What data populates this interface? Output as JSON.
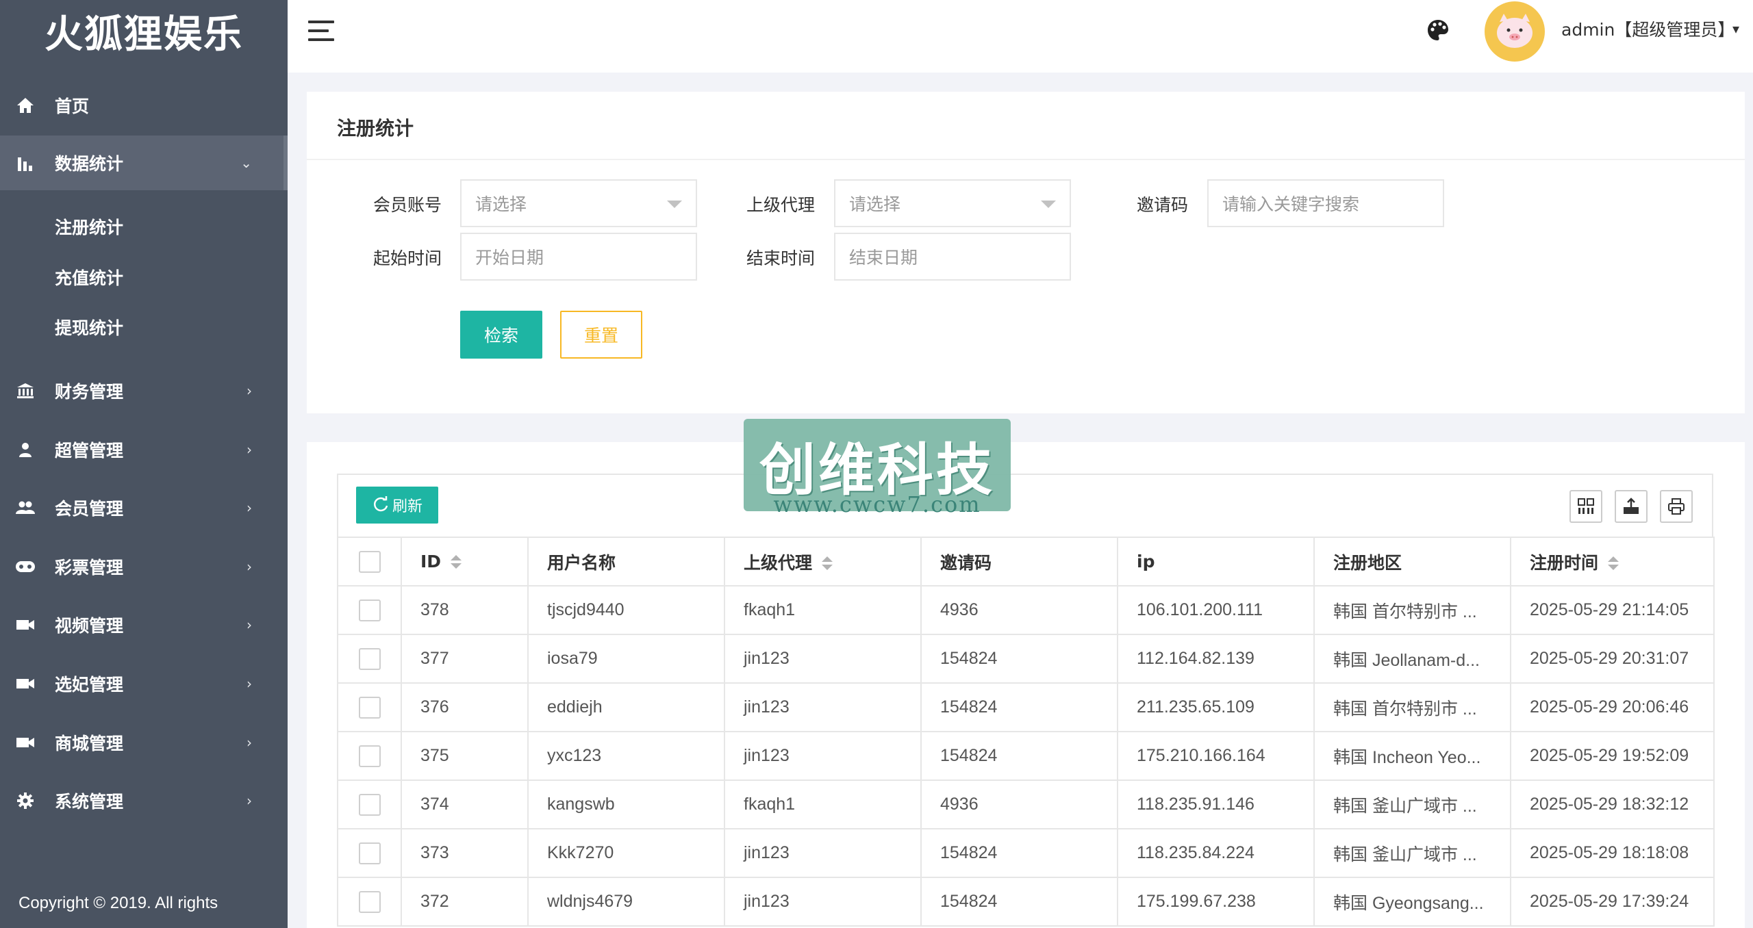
{
  "app": {
    "logo": "火狐狸娱乐"
  },
  "sidebar": {
    "items": [
      {
        "label": "首页",
        "icon": "home-icon"
      },
      {
        "label": "数据统计",
        "icon": "bar-chart-icon",
        "expanded": true
      },
      {
        "label": "财务管理",
        "icon": "bank-icon"
      },
      {
        "label": "超管管理",
        "icon": "user-icon"
      },
      {
        "label": "会员管理",
        "icon": "users-icon"
      },
      {
        "label": "彩票管理",
        "icon": "gamepad-icon"
      },
      {
        "label": "视频管理",
        "icon": "video-icon"
      },
      {
        "label": "选妃管理",
        "icon": "video-icon"
      },
      {
        "label": "商城管理",
        "icon": "video-icon"
      },
      {
        "label": "系统管理",
        "icon": "gear-icon"
      }
    ],
    "subitems": [
      "注册统计",
      "充值统计",
      "提现统计"
    ],
    "copyright": "Copyright © 2019. All rights"
  },
  "header": {
    "user": "admin【超级管理员】"
  },
  "search": {
    "title": "注册统计",
    "member_label": "会员账号",
    "member_placeholder": "请选择",
    "agent_label": "上级代理",
    "agent_placeholder": "请选择",
    "invite_label": "邀请码",
    "invite_placeholder": "请输入关键字搜索",
    "start_label": "起始时间",
    "start_placeholder": "开始日期",
    "end_label": "结束时间",
    "end_placeholder": "结束日期",
    "search_button": "检索",
    "reset_button": "重置"
  },
  "table": {
    "refresh_label": "刷新",
    "columns": [
      "ID",
      "用户名称",
      "上级代理",
      "邀请码",
      "ip",
      "注册地区",
      "注册时间"
    ],
    "rows": [
      [
        "378",
        "tjscjd9440",
        "fkaqh1",
        "4936",
        "106.101.200.111",
        "韩国 首尔特别市 ...",
        "2025-05-29 21:14:05"
      ],
      [
        "377",
        "iosa79",
        "jin123",
        "154824",
        "112.164.82.139",
        "韩国 Jeollanam-d...",
        "2025-05-29 20:31:07"
      ],
      [
        "376",
        "eddiejh",
        "jin123",
        "154824",
        "211.235.65.109",
        "韩国 首尔特别市 ...",
        "2025-05-29 20:06:46"
      ],
      [
        "375",
        "yxc123",
        "jin123",
        "154824",
        "175.210.166.164",
        "韩国 Incheon Yeo...",
        "2025-05-29 19:52:09"
      ],
      [
        "374",
        "kangswb",
        "fkaqh1",
        "4936",
        "118.235.91.146",
        "韩国 釜山广域市 ...",
        "2025-05-29 18:32:12"
      ],
      [
        "373",
        "Kkk7270",
        "jin123",
        "154824",
        "118.235.84.224",
        "韩国 釜山广域市 ...",
        "2025-05-29 18:18:08"
      ],
      [
        "372",
        "wldnjs4679",
        "jin123",
        "154824",
        "175.199.67.238",
        "韩国 Gyeongsang...",
        "2025-05-29 17:39:24"
      ]
    ]
  },
  "watermark": {
    "text": "创维科技",
    "url": "www.cwcw7.com"
  },
  "colors": {
    "sidebar": "#4a5361",
    "accent": "#1eb5a3",
    "warning": "#f7b824"
  }
}
